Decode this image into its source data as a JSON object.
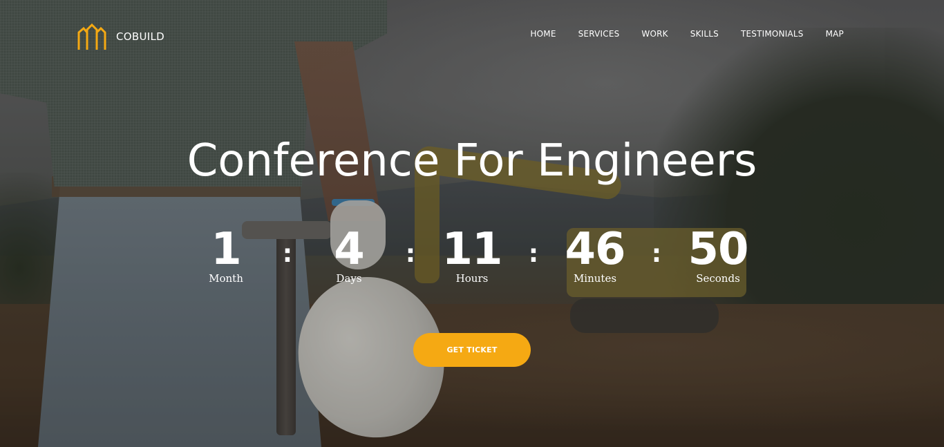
{
  "brand": {
    "name": "COBUILD",
    "accent_color": "#f5a913",
    "logo_icon": "buildings-logo-icon"
  },
  "nav": {
    "items": [
      {
        "label": "HOME"
      },
      {
        "label": "SERVICES"
      },
      {
        "label": "WORK"
      },
      {
        "label": "SKILLS"
      },
      {
        "label": "TESTIMONIALS"
      },
      {
        "label": "MAP"
      }
    ]
  },
  "hero": {
    "title": "Conference For Engineers",
    "countdown": {
      "separator": ":",
      "units": [
        {
          "value": "1",
          "label": "Month"
        },
        {
          "value": "4",
          "label": "Days"
        },
        {
          "value": "11",
          "label": "Hours"
        },
        {
          "value": "46",
          "label": "Minutes"
        },
        {
          "value": "50",
          "label": "Seconds"
        }
      ]
    },
    "cta_label": "GET TICKET"
  }
}
